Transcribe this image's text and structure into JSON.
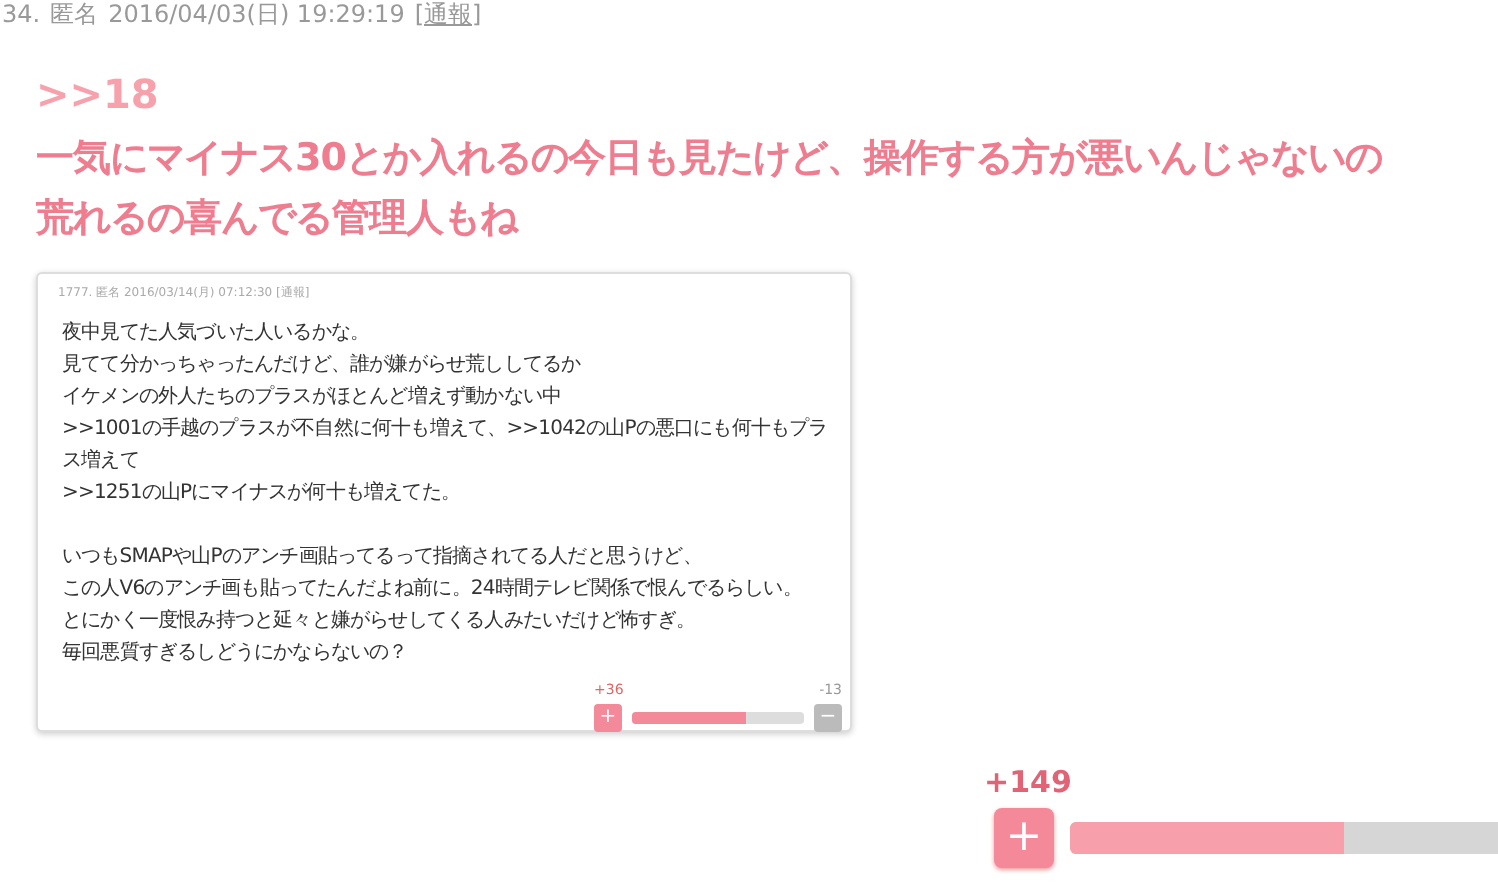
{
  "post": {
    "number": "34.",
    "author": "匿名",
    "date": "2016/04/03(日) 19:29:19",
    "report_link": "[通報]",
    "reply_anchor": ">>18",
    "body_lines": [
      "一気にマイナス30とか入れるの今日も見たけど、操作する方が悪いんじゃないの",
      "荒れるの喜んでる管理人もね"
    ],
    "quoted_screenshot": {
      "header": "1777. 匿名 2016/03/14(月) 07:12:30 [通報]",
      "paragraphs": [
        [
          "夜中見てた人気づいた人いるかな。",
          "見てて分かっちゃったんだけど、誰が嫌がらせ荒ししてるか",
          "イケメンの外人たちのプラスがほとんど増えず動かない中",
          ">>1001の手越のプラスが不自然に何十も増えて、>>1042の山Pの悪口にも何十もプラス増えて",
          ">>1251の山Pにマイナスが何十も増えてた。"
        ],
        [
          "いつもSMAPや山Pのアンチ画貼ってるって指摘されてる人だと思うけど、",
          "この人V6のアンチ画も貼ってたんだよね前に。24時間テレビ関係で恨んでるらしい。",
          "とにかく一度恨み持つと延々と嫌がらせしてくる人みたいだけど怖すぎ。",
          "毎回悪質すぎるしどうにかならないの？"
        ]
      ],
      "vote": {
        "plus_count": "+36",
        "minus_count": "-13",
        "plus_label": "+",
        "minus_label": "−",
        "level": 0.66
      }
    },
    "vote": {
      "plus_count": "+149",
      "plus_label": "+",
      "level": 0.64
    }
  }
}
